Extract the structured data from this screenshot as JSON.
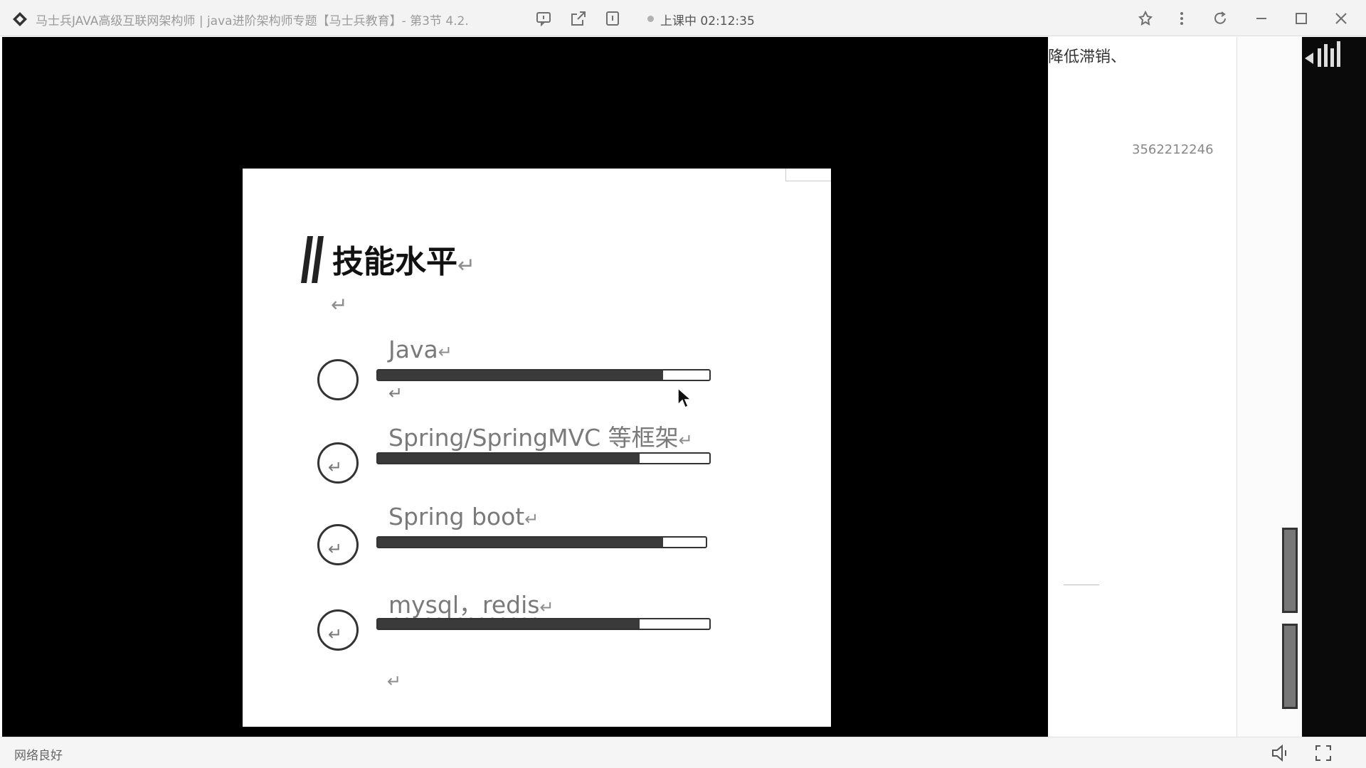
{
  "window": {
    "title": "马士兵JAVA高级互联网架构师 | java进阶架构师专题【马士兵教育】- 第3节 4.2.",
    "live_status": "上课中",
    "timer": "02:12:35"
  },
  "slide": {
    "title": "技能水平",
    "para_mark": "↵",
    "skills": [
      {
        "label": "Java",
        "level": 0.86
      },
      {
        "label": "Spring/SpringMVC 等框架",
        "level": 0.79
      },
      {
        "label": "Spring boot",
        "level": 0.87
      },
      {
        "label": "mysql，redis",
        "level": 0.79
      }
    ]
  },
  "side_panel": {
    "top_text": "降低滞销、",
    "number": "3562212246"
  },
  "bottom": {
    "network_status": "网络良好"
  },
  "colors": {
    "video_bg": "#000000",
    "bar_fill": "#3a3a3a"
  },
  "icons": [
    "app-logo-icon",
    "chat-icon",
    "share-icon",
    "info-icon",
    "pin-icon",
    "more-icon",
    "refresh-icon",
    "minimize-icon",
    "maximize-icon",
    "close-icon",
    "volume-icon",
    "fullscreen-icon",
    "bilibili-logo"
  ]
}
